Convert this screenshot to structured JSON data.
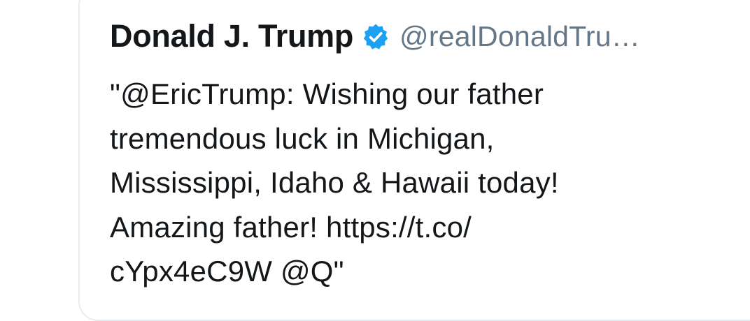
{
  "tweet": {
    "display_name": "Donald J. Trump",
    "verified_icon": "verified-badge-icon",
    "handle": "@realDonaldTru…",
    "text_lines": [
      "\"@EricTrump: Wishing our father",
      "tremendous luck in Michigan,",
      "Mississippi, Idaho & Hawaii today!",
      "Amazing father! https://t.co/",
      "cYpx4eC9W @Q\""
    ]
  },
  "colors": {
    "verified_blue": "#1da1f2",
    "handle_gray": "#657786",
    "text": "#14171a"
  }
}
